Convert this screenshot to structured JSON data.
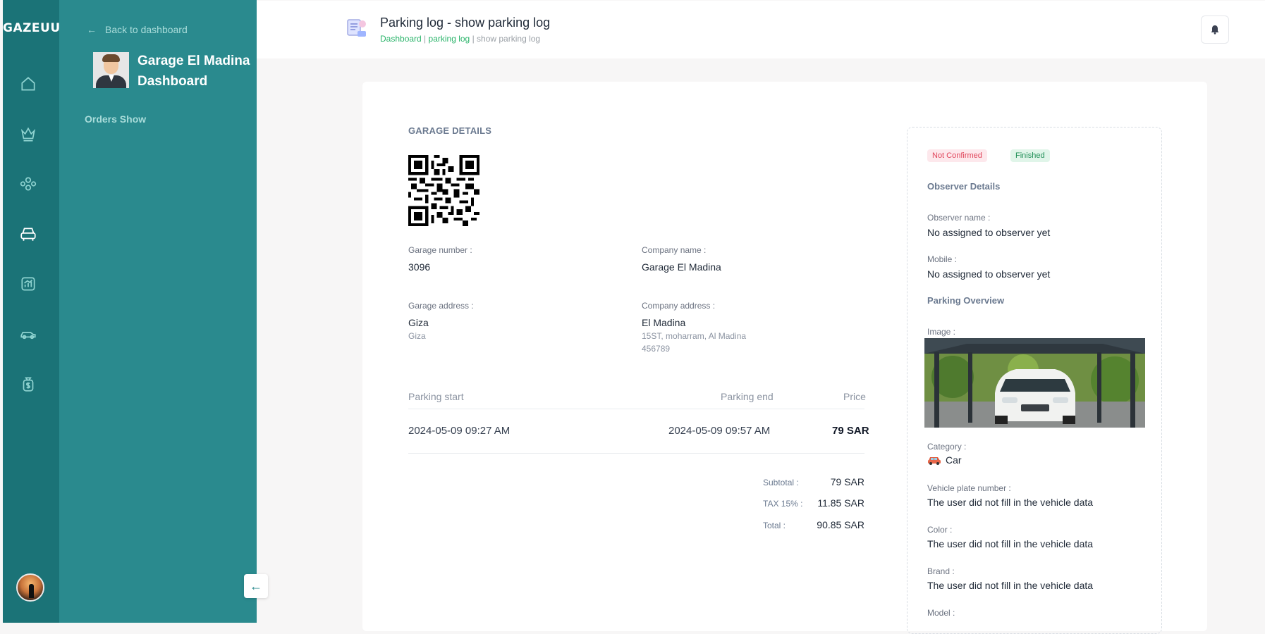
{
  "brand": {
    "logo_text": "GAZEUUE"
  },
  "sidebar": {
    "back_label": "Back to dashboard",
    "profile_name": "Garage El Madina Dashboard",
    "orders_show": "Orders Show"
  },
  "rail_icons": [
    "home-icon",
    "crown-icon",
    "users-icon",
    "car-front-icon",
    "analytics-icon",
    "car-side-icon",
    "money-bag-icon"
  ],
  "header": {
    "title": "Parking log - show parking log",
    "breadcrumb": {
      "b1": "Dashboard",
      "b2": "parking log",
      "b3": "show parking log",
      "sep": " | "
    }
  },
  "garage": {
    "section_title": "GARAGE DETAILS",
    "number_label": "Garage number :",
    "number": "3096",
    "company_label": "Company name :",
    "company": "Garage El Madina",
    "address_label": "Garage address :",
    "address": "Giza",
    "address_sub": "Giza",
    "company_address_label": "Company address :",
    "company_address": "El Madina",
    "company_address_line1": "15ST, moharram, Al Madina",
    "company_address_line2": "456789"
  },
  "table": {
    "headers": {
      "start": "Parking start",
      "end": "Parking end",
      "price": "Price"
    },
    "row": {
      "start": "2024-05-09 09:27 AM",
      "end": "2024-05-09 09:57 AM",
      "price": "79 SAR"
    }
  },
  "summary": {
    "subtotal_label": "Subtotal :",
    "subtotal": "79 SAR",
    "tax_label": "TAX 15% :",
    "tax": "11.85 SAR",
    "total_label": "Total :",
    "total": "90.85 SAR"
  },
  "status": {
    "confirm": "Not Confirmed",
    "state": "Finished"
  },
  "observer": {
    "section_title": "Observer Details",
    "name_label": "Observer name :",
    "name": "No assigned to observer yet",
    "mobile_label": "Mobile :",
    "mobile": "No assigned to observer yet"
  },
  "parking": {
    "section_title": "Parking Overview",
    "image_label": "Image :",
    "category_label": "Category :",
    "category": "Car",
    "plate_label": "Vehicle plate number :",
    "plate": "The user did not fill in the vehicle data",
    "color_label": "Color :",
    "color": "The user did not fill in the vehicle data",
    "brand_label": "Brand :",
    "brand": "The user did not fill in the vehicle data",
    "model_label": "Model :"
  },
  "colors": {
    "rail": "#1b7377",
    "panel": "#2a8a8e",
    "accent_green": "#2ab46a",
    "danger": "#e0445a"
  }
}
